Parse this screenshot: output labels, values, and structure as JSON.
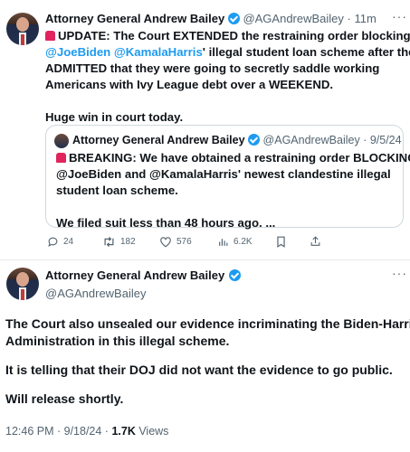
{
  "tweet1": {
    "name": "Attorney General Andrew Bailey",
    "handle_time": "@AGAndrewBailey · 11m",
    "line1_a": "UPDATE: The Court EXTENDED the restraining order blocking",
    "mention1": "@JoeBiden",
    "mention2": "@KamalaHarris",
    "line2_rest": "' illegal student loan scheme after they",
    "line3": "ADMITTED that they were going to secretly saddle working",
    "line4": "Americans with Ivy League debt over a WEEKEND.",
    "line5": "Huge win in court today."
  },
  "quote": {
    "name": "Attorney General Andrew Bailey",
    "handle_time": "@AGAndrewBailey · 9/5/24",
    "line1": "BREAKING: We have obtained a restraining order BLOCKING",
    "line2": "@JoeBiden and @KamalaHarris' newest clandestine illegal",
    "line3": "student loan scheme.",
    "line4": "We filed suit less than 48 hours ago. ..."
  },
  "actions": {
    "replies": "24",
    "retweets": "182",
    "likes": "576",
    "views": "6.2K"
  },
  "tweet2": {
    "name": "Attorney General Andrew Bailey",
    "handle": "@AGAndrewBailey",
    "p1_l1": "The Court also unsealed our evidence incriminating the Biden-Harris",
    "p1_l2": "Administration in this illegal scheme.",
    "p2": "It is telling that their DOJ did not want the evidence to go public.",
    "p3": "Will release shortly.",
    "meta_time": "12:46 PM · 9/18/24 · ",
    "meta_views": "1.7K",
    "meta_views_label": " Views"
  },
  "colors": {
    "accent": "#1d9bf0",
    "text": "#0f1419",
    "muted": "#536471"
  }
}
